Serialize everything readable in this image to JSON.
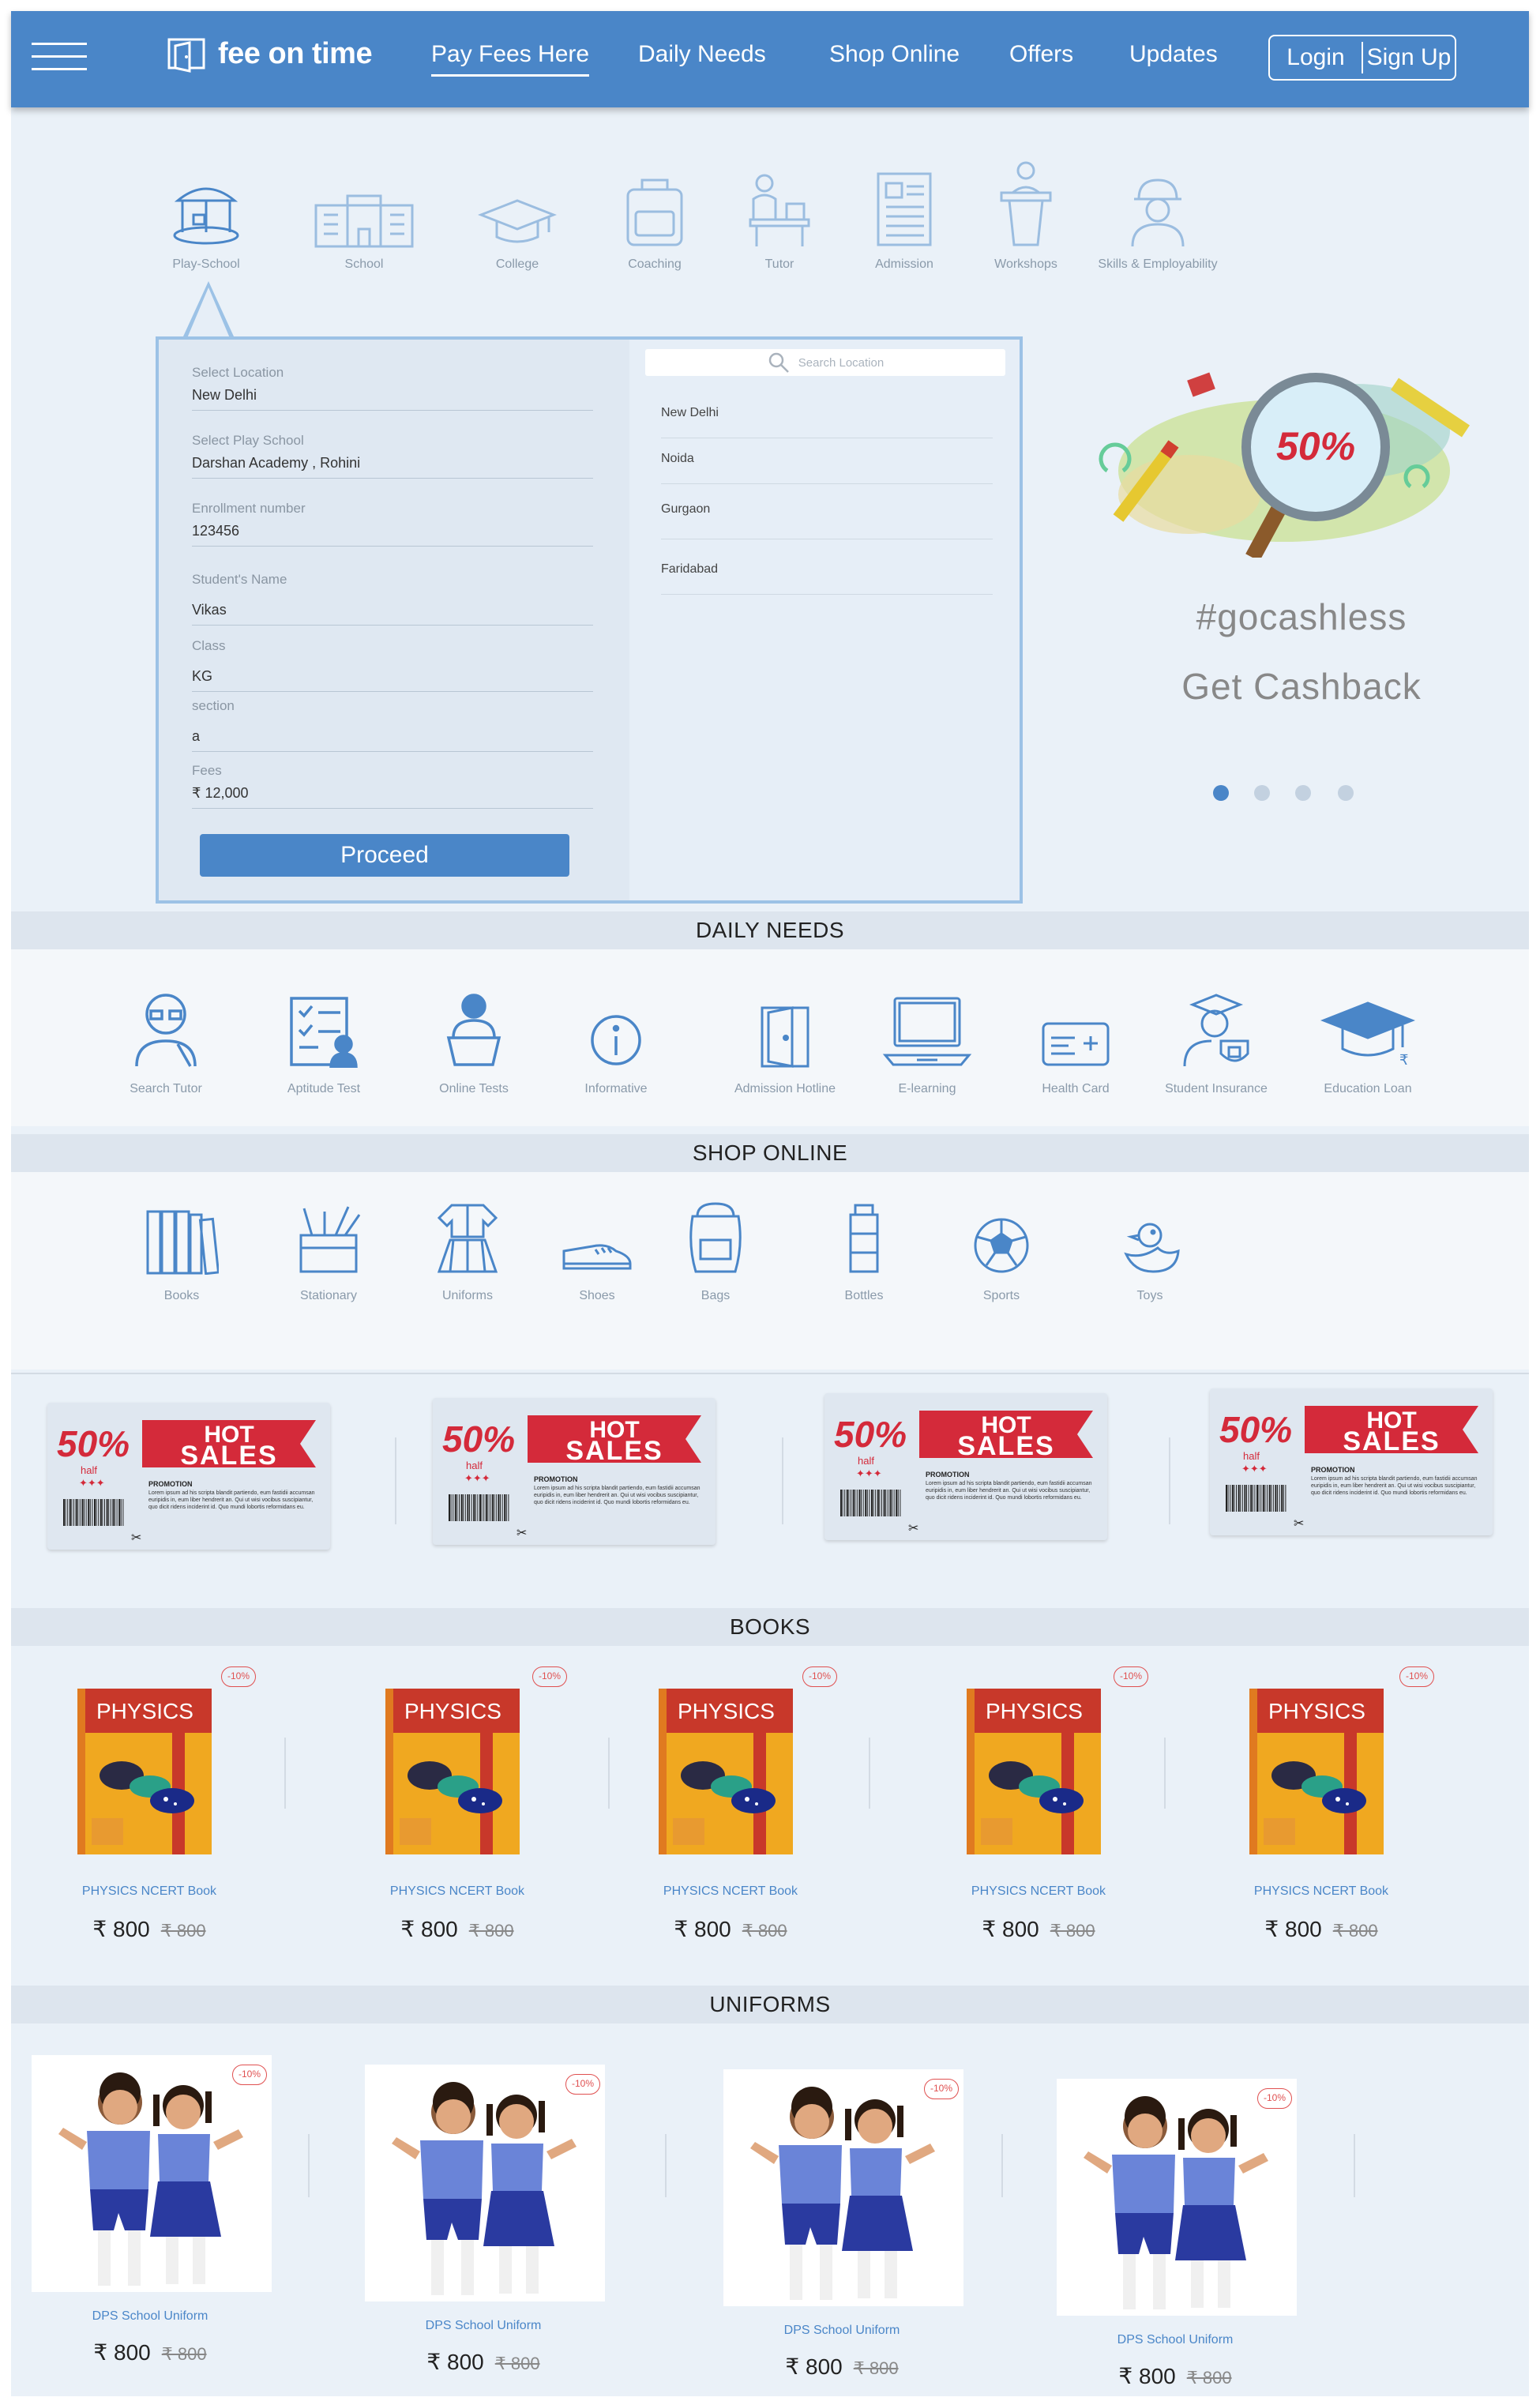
{
  "header": {
    "logo": "fee on time",
    "nav": [
      "Pay Fees Here",
      "Daily Needs",
      "Shop Online",
      "Offers",
      "Updates"
    ],
    "login": "Login",
    "signup": "Sign Up"
  },
  "categories": [
    "Play-School",
    "School",
    "College",
    "Coaching",
    "Tutor",
    "Admission",
    "Workshops",
    "Skills & Employability"
  ],
  "form": {
    "fields": [
      {
        "label": "Select Location",
        "value": "New Delhi"
      },
      {
        "label": "Select Play School",
        "value": "Darshan Academy , Rohini"
      },
      {
        "label": "Enrollment number",
        "value": "123456"
      },
      {
        "label": "Student's Name",
        "value": "Vikas"
      },
      {
        "label": "Class",
        "value": "KG"
      },
      {
        "label": "section",
        "value": "a"
      },
      {
        "label": "Fees",
        "value": "₹ 12,000"
      }
    ],
    "proceed": "Proceed",
    "search_placeholder": "Search Location",
    "locations": [
      "New Delhi",
      "Noida",
      "Gurgaon",
      "Faridabad"
    ]
  },
  "promo": {
    "badge": "50%",
    "line1": "#gocashless",
    "line2": "Get Cashback"
  },
  "daily_needs": {
    "title": "DAILY NEEDS",
    "items": [
      "Search Tutor",
      "Aptitude Test",
      "Online Tests",
      "Informative",
      "Admission Hotline",
      "E-learning",
      "Health Card",
      "Student Insurance",
      "Education Loan"
    ]
  },
  "shop_online": {
    "title": "SHOP ONLINE",
    "items": [
      "Books",
      "Stationary",
      "Uniforms",
      "Shoes",
      "Bags",
      "Bottles",
      "Sports",
      "Toys"
    ]
  },
  "coupon": {
    "pct": "50%",
    "half": "half",
    "hot": "HOT",
    "sales": "SALES",
    "promo": "PROMOTION",
    "text": "Lorem ipsum ad his scripta blandit partiendo, eum fastidii accumsan euripidis in, eum liber hendrerit an. Qui ut wisi vocibus suscipiantur, quo dicit ridens inciderint id. Quo mundi lobortis reformidans eu."
  },
  "books": {
    "title": "BOOKS",
    "cover_title": "PHYSICS",
    "name": "PHYSICS NCERT Book",
    "price": "₹ 800",
    "old": "₹ 800",
    "discount": "-10%"
  },
  "uniforms": {
    "title": "UNIFORMS",
    "name": "DPS School Uniform",
    "price": "₹ 800",
    "old": "₹ 800",
    "discount": "-10%"
  }
}
